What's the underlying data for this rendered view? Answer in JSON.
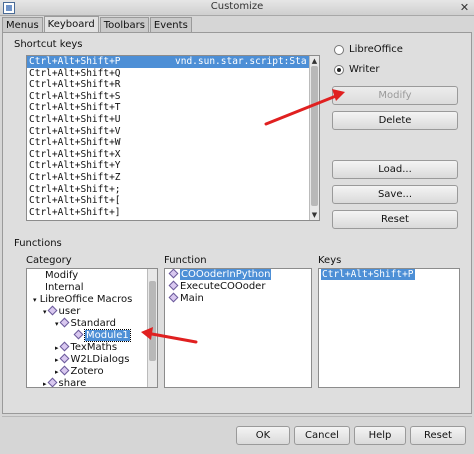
{
  "window": {
    "title": "Customize"
  },
  "tabs": [
    {
      "label": "Menus"
    },
    {
      "label": "Keyboard"
    },
    {
      "label": "Toolbars"
    },
    {
      "label": "Events"
    }
  ],
  "shortcut_section": {
    "label": "Shortcut keys",
    "rows": [
      {
        "key": "Ctrl+Alt+Shift+P",
        "command": "vnd.sun.star.script:Sta"
      },
      {
        "key": "Ctrl+Alt+Shift+Q",
        "command": ""
      },
      {
        "key": "Ctrl+Alt+Shift+R",
        "command": ""
      },
      {
        "key": "Ctrl+Alt+Shift+S",
        "command": ""
      },
      {
        "key": "Ctrl+Alt+Shift+T",
        "command": ""
      },
      {
        "key": "Ctrl+Alt+Shift+U",
        "command": ""
      },
      {
        "key": "Ctrl+Alt+Shift+V",
        "command": ""
      },
      {
        "key": "Ctrl+Alt+Shift+W",
        "command": ""
      },
      {
        "key": "Ctrl+Alt+Shift+X",
        "command": ""
      },
      {
        "key": "Ctrl+Alt+Shift+Y",
        "command": ""
      },
      {
        "key": "Ctrl+Alt+Shift+Z",
        "command": ""
      },
      {
        "key": "Ctrl+Alt+Shift+;",
        "command": ""
      },
      {
        "key": "Ctrl+Alt+Shift+[",
        "command": ""
      },
      {
        "key": "Ctrl+Alt+Shift+]",
        "command": ""
      }
    ]
  },
  "scope": {
    "libreoffice": "LibreOffice",
    "writer": "Writer",
    "selected": "Writer"
  },
  "right_buttons": {
    "modify": "Modify",
    "delete": "Delete",
    "load": "Load...",
    "save": "Save...",
    "reset": "Reset"
  },
  "functions": {
    "label": "Functions",
    "category_label": "Category",
    "function_label": "Function",
    "keys_label": "Keys",
    "categories": [
      {
        "label": "Modify"
      },
      {
        "label": "Internal"
      },
      {
        "label": "LibreOffice Macros"
      },
      {
        "label": "user"
      },
      {
        "label": "Standard"
      },
      {
        "label": "Module1"
      },
      {
        "label": "TexMaths"
      },
      {
        "label": "W2LDialogs"
      },
      {
        "label": "Zotero"
      },
      {
        "label": "share"
      }
    ],
    "function_items": [
      {
        "label": "COOoderInPython"
      },
      {
        "label": "ExecuteCOOoder"
      },
      {
        "label": "Main"
      }
    ],
    "key_items": [
      {
        "label": "Ctrl+Alt+Shift+P"
      }
    ]
  },
  "bottom_buttons": {
    "ok": "OK",
    "cancel": "Cancel",
    "help": "Help",
    "reset": "Reset"
  },
  "colors": {
    "selection": "#4d8fd6",
    "annotation_arrow": "#e02020"
  }
}
